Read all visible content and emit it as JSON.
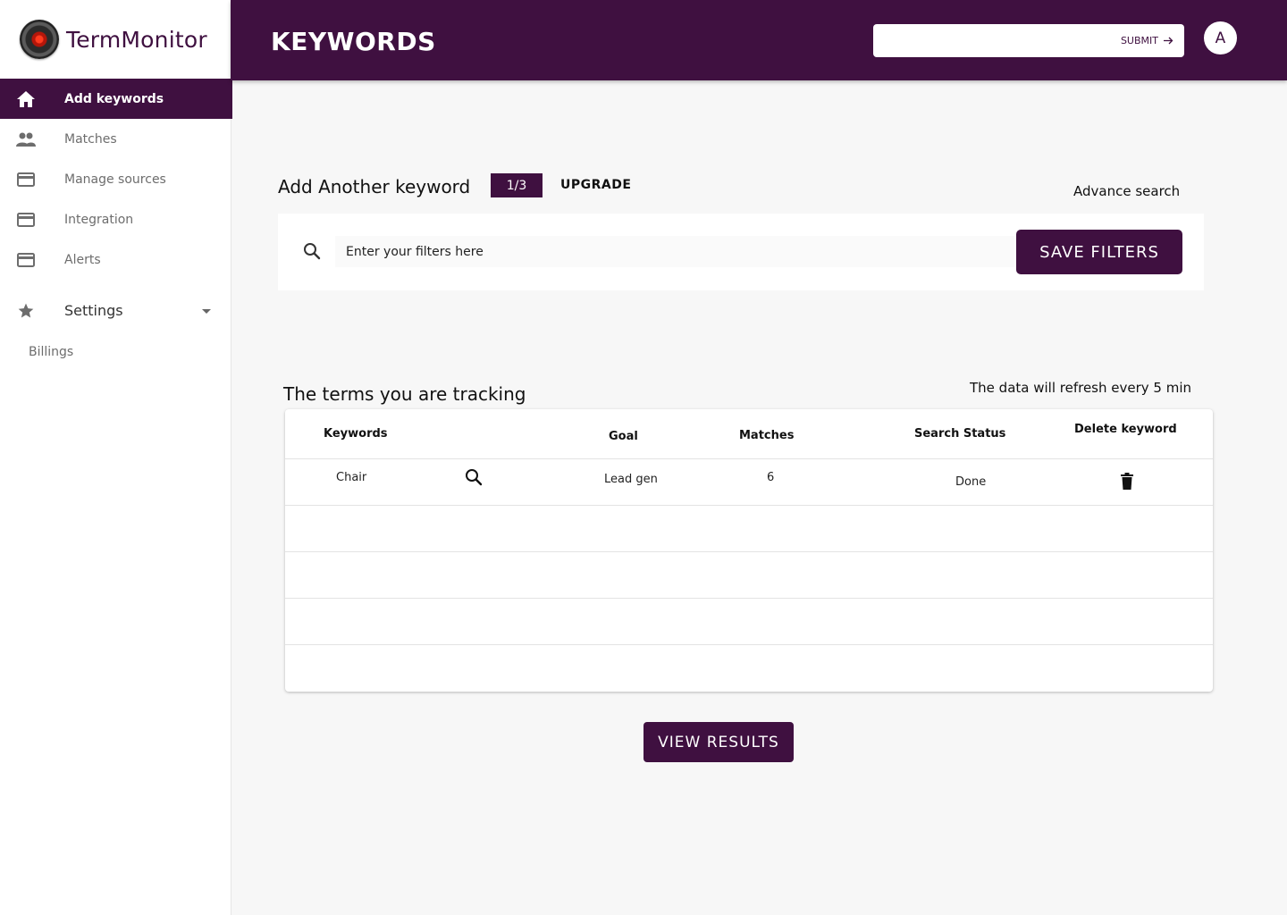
{
  "brand": {
    "name": "TermMonitor"
  },
  "sidebar": {
    "items": [
      {
        "label": "Add keywords",
        "icon": "home-icon",
        "active": true
      },
      {
        "label": "Matches",
        "icon": "people-icon"
      },
      {
        "label": "Manage sources",
        "icon": "card-icon"
      },
      {
        "label": "Integration",
        "icon": "card-icon"
      },
      {
        "label": "Alerts",
        "icon": "card-icon"
      }
    ],
    "settings": {
      "label": "Settings",
      "icon": "star-icon"
    },
    "billings": "Billings"
  },
  "header": {
    "title": "KEYWORDS",
    "submit_label": "SUBMIT",
    "submit_value": "",
    "avatar_initial": "A"
  },
  "add_keyword": {
    "title": "Add Another keyword",
    "counter": "1/3",
    "upgrade": "UPGRADE",
    "advance_search": "Advance search",
    "filter_placeholder": "Enter your filters here",
    "save_label": "SAVE FILTERS"
  },
  "tracking": {
    "title": "The terms you are tracking",
    "refresh_note": "The data will refresh every 5 min",
    "columns": [
      "Keywords",
      "Goal",
      "Matches",
      "Search Status",
      "Delete keyword"
    ],
    "rows": [
      {
        "keyword": "Chair",
        "goal": "Lead gen",
        "matches": "6",
        "status": "Done"
      }
    ],
    "view_results": "VIEW RESULTS"
  },
  "colors": {
    "primary": "#3f1040",
    "background": "#f7f7f7"
  }
}
